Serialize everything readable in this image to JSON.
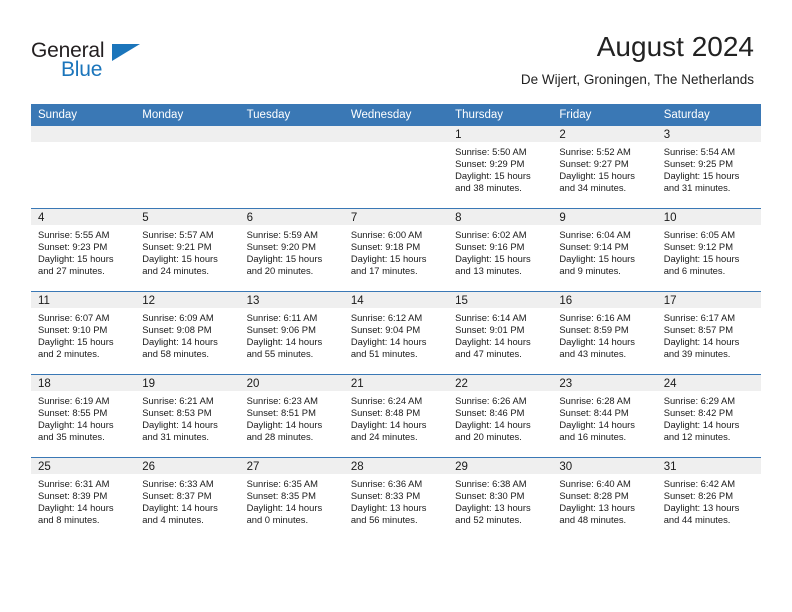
{
  "brand": {
    "name_part1": "General",
    "name_part2": "Blue",
    "triangle_color": "#1b75bb"
  },
  "header": {
    "title": "August 2024",
    "location": "De Wijert, Groningen, The Netherlands"
  },
  "theme": {
    "header_blue": "#3a78b5",
    "daynum_band": "#efefef",
    "text": "#1a1a1a"
  },
  "weekday_headers": [
    "Sunday",
    "Monday",
    "Tuesday",
    "Wednesday",
    "Thursday",
    "Friday",
    "Saturday"
  ],
  "labels": {
    "sunrise_prefix": "Sunrise:",
    "sunset_prefix": "Sunset:",
    "daylight_prefix": "Daylight:"
  },
  "weeks": [
    [
      {
        "day": "",
        "empty": true,
        "sunrise": "",
        "sunset": "",
        "daylight": ""
      },
      {
        "day": "",
        "empty": true,
        "sunrise": "",
        "sunset": "",
        "daylight": ""
      },
      {
        "day": "",
        "empty": true,
        "sunrise": "",
        "sunset": "",
        "daylight": ""
      },
      {
        "day": "",
        "empty": true,
        "sunrise": "",
        "sunset": "",
        "daylight": ""
      },
      {
        "day": "1",
        "empty": false,
        "sunrise": "Sunrise: 5:50 AM",
        "sunset": "Sunset: 9:29 PM",
        "daylight": "Daylight: 15 hours and 38 minutes."
      },
      {
        "day": "2",
        "empty": false,
        "sunrise": "Sunrise: 5:52 AM",
        "sunset": "Sunset: 9:27 PM",
        "daylight": "Daylight: 15 hours and 34 minutes."
      },
      {
        "day": "3",
        "empty": false,
        "sunrise": "Sunrise: 5:54 AM",
        "sunset": "Sunset: 9:25 PM",
        "daylight": "Daylight: 15 hours and 31 minutes."
      }
    ],
    [
      {
        "day": "4",
        "empty": false,
        "sunrise": "Sunrise: 5:55 AM",
        "sunset": "Sunset: 9:23 PM",
        "daylight": "Daylight: 15 hours and 27 minutes."
      },
      {
        "day": "5",
        "empty": false,
        "sunrise": "Sunrise: 5:57 AM",
        "sunset": "Sunset: 9:21 PM",
        "daylight": "Daylight: 15 hours and 24 minutes."
      },
      {
        "day": "6",
        "empty": false,
        "sunrise": "Sunrise: 5:59 AM",
        "sunset": "Sunset: 9:20 PM",
        "daylight": "Daylight: 15 hours and 20 minutes."
      },
      {
        "day": "7",
        "empty": false,
        "sunrise": "Sunrise: 6:00 AM",
        "sunset": "Sunset: 9:18 PM",
        "daylight": "Daylight: 15 hours and 17 minutes."
      },
      {
        "day": "8",
        "empty": false,
        "sunrise": "Sunrise: 6:02 AM",
        "sunset": "Sunset: 9:16 PM",
        "daylight": "Daylight: 15 hours and 13 minutes."
      },
      {
        "day": "9",
        "empty": false,
        "sunrise": "Sunrise: 6:04 AM",
        "sunset": "Sunset: 9:14 PM",
        "daylight": "Daylight: 15 hours and 9 minutes."
      },
      {
        "day": "10",
        "empty": false,
        "sunrise": "Sunrise: 6:05 AM",
        "sunset": "Sunset: 9:12 PM",
        "daylight": "Daylight: 15 hours and 6 minutes."
      }
    ],
    [
      {
        "day": "11",
        "empty": false,
        "sunrise": "Sunrise: 6:07 AM",
        "sunset": "Sunset: 9:10 PM",
        "daylight": "Daylight: 15 hours and 2 minutes."
      },
      {
        "day": "12",
        "empty": false,
        "sunrise": "Sunrise: 6:09 AM",
        "sunset": "Sunset: 9:08 PM",
        "daylight": "Daylight: 14 hours and 58 minutes."
      },
      {
        "day": "13",
        "empty": false,
        "sunrise": "Sunrise: 6:11 AM",
        "sunset": "Sunset: 9:06 PM",
        "daylight": "Daylight: 14 hours and 55 minutes."
      },
      {
        "day": "14",
        "empty": false,
        "sunrise": "Sunrise: 6:12 AM",
        "sunset": "Sunset: 9:04 PM",
        "daylight": "Daylight: 14 hours and 51 minutes."
      },
      {
        "day": "15",
        "empty": false,
        "sunrise": "Sunrise: 6:14 AM",
        "sunset": "Sunset: 9:01 PM",
        "daylight": "Daylight: 14 hours and 47 minutes."
      },
      {
        "day": "16",
        "empty": false,
        "sunrise": "Sunrise: 6:16 AM",
        "sunset": "Sunset: 8:59 PM",
        "daylight": "Daylight: 14 hours and 43 minutes."
      },
      {
        "day": "17",
        "empty": false,
        "sunrise": "Sunrise: 6:17 AM",
        "sunset": "Sunset: 8:57 PM",
        "daylight": "Daylight: 14 hours and 39 minutes."
      }
    ],
    [
      {
        "day": "18",
        "empty": false,
        "sunrise": "Sunrise: 6:19 AM",
        "sunset": "Sunset: 8:55 PM",
        "daylight": "Daylight: 14 hours and 35 minutes."
      },
      {
        "day": "19",
        "empty": false,
        "sunrise": "Sunrise: 6:21 AM",
        "sunset": "Sunset: 8:53 PM",
        "daylight": "Daylight: 14 hours and 31 minutes."
      },
      {
        "day": "20",
        "empty": false,
        "sunrise": "Sunrise: 6:23 AM",
        "sunset": "Sunset: 8:51 PM",
        "daylight": "Daylight: 14 hours and 28 minutes."
      },
      {
        "day": "21",
        "empty": false,
        "sunrise": "Sunrise: 6:24 AM",
        "sunset": "Sunset: 8:48 PM",
        "daylight": "Daylight: 14 hours and 24 minutes."
      },
      {
        "day": "22",
        "empty": false,
        "sunrise": "Sunrise: 6:26 AM",
        "sunset": "Sunset: 8:46 PM",
        "daylight": "Daylight: 14 hours and 20 minutes."
      },
      {
        "day": "23",
        "empty": false,
        "sunrise": "Sunrise: 6:28 AM",
        "sunset": "Sunset: 8:44 PM",
        "daylight": "Daylight: 14 hours and 16 minutes."
      },
      {
        "day": "24",
        "empty": false,
        "sunrise": "Sunrise: 6:29 AM",
        "sunset": "Sunset: 8:42 PM",
        "daylight": "Daylight: 14 hours and 12 minutes."
      }
    ],
    [
      {
        "day": "25",
        "empty": false,
        "sunrise": "Sunrise: 6:31 AM",
        "sunset": "Sunset: 8:39 PM",
        "daylight": "Daylight: 14 hours and 8 minutes."
      },
      {
        "day": "26",
        "empty": false,
        "sunrise": "Sunrise: 6:33 AM",
        "sunset": "Sunset: 8:37 PM",
        "daylight": "Daylight: 14 hours and 4 minutes."
      },
      {
        "day": "27",
        "empty": false,
        "sunrise": "Sunrise: 6:35 AM",
        "sunset": "Sunset: 8:35 PM",
        "daylight": "Daylight: 14 hours and 0 minutes."
      },
      {
        "day": "28",
        "empty": false,
        "sunrise": "Sunrise: 6:36 AM",
        "sunset": "Sunset: 8:33 PM",
        "daylight": "Daylight: 13 hours and 56 minutes."
      },
      {
        "day": "29",
        "empty": false,
        "sunrise": "Sunrise: 6:38 AM",
        "sunset": "Sunset: 8:30 PM",
        "daylight": "Daylight: 13 hours and 52 minutes."
      },
      {
        "day": "30",
        "empty": false,
        "sunrise": "Sunrise: 6:40 AM",
        "sunset": "Sunset: 8:28 PM",
        "daylight": "Daylight: 13 hours and 48 minutes."
      },
      {
        "day": "31",
        "empty": false,
        "sunrise": "Sunrise: 6:42 AM",
        "sunset": "Sunset: 8:26 PM",
        "daylight": "Daylight: 13 hours and 44 minutes."
      }
    ]
  ]
}
